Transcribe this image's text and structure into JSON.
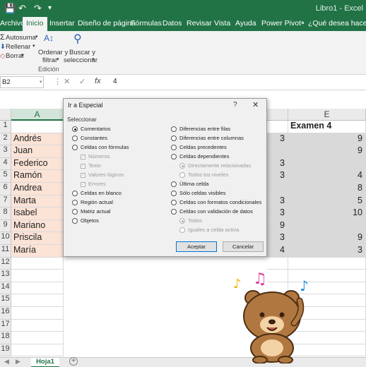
{
  "window": {
    "title": "Libro1 - Excel"
  },
  "tabs": [
    "Archivo",
    "Inicio",
    "Insertar",
    "Diseño de página",
    "Fórmulas",
    "Datos",
    "Revisar",
    "Vista",
    "Ayuda",
    "Power Pivot",
    "¿Qué desea hacer?"
  ],
  "ribbon": {
    "autosuma": "Autosuma",
    "rellenar": "Rellenar",
    "borrar": "Borrar",
    "ordenar1": "Ordenar y",
    "ordenar2": "filtrar",
    "buscar1": "Buscar y",
    "buscar2": "seleccionar",
    "group": "Edición"
  },
  "formula_bar": {
    "name_box": "B2",
    "fx": "fx",
    "value": "4"
  },
  "columns": {
    "a": "A",
    "e": "E"
  },
  "rows": [
    "1",
    "2",
    "3",
    "4",
    "5",
    "6",
    "7",
    "8",
    "9",
    "10",
    "11",
    "12",
    "13",
    "14",
    "15",
    "16",
    "17",
    "18",
    "19"
  ],
  "names": [
    "Andrés",
    "Juan",
    "Federico",
    "Ramón",
    "Andrea",
    "Marta",
    "Isabel",
    "Mariano",
    "Priscila",
    "María"
  ],
  "col_d_values": [
    "3",
    "",
    "3",
    "3",
    "",
    "3",
    "3",
    "9",
    "3",
    "4"
  ],
  "header_e": "Examen 4",
  "col_e_values": [
    "9",
    "9",
    "",
    "4",
    "8",
    "5",
    "10",
    "",
    "9",
    "3"
  ],
  "sheet": {
    "tab": "Hoja1",
    "add": "+"
  },
  "dialog": {
    "title": "Ir a Especial",
    "help": "?",
    "close": "✕",
    "section": "Seleccionar",
    "left_options": [
      "Comentarios",
      "Constantes",
      "Celdas con fórmulas",
      "Números",
      "Texto",
      "Valores lógicos",
      "Errores",
      "Celdas en blanco",
      "Región actual",
      "Matriz actual",
      "Objetos"
    ],
    "right_options": [
      "Diferencias entre filas",
      "Diferencias entre columnas",
      "Celdas precedentes",
      "Celdas dependientes",
      "Directamente relacionadas",
      "Todos los niveles",
      "Última celda",
      "Sólo celdas visibles",
      "Celdas con formatos condicionales",
      "Celdas con validación de datos",
      "Todos",
      "Iguales a celda activa"
    ],
    "accept": "Aceptar",
    "cancel": "Cancelar"
  },
  "colors": {
    "excel_green": "#217346",
    "name_fill": "#fbe3d6",
    "value_fill": "#d9d9d9"
  }
}
